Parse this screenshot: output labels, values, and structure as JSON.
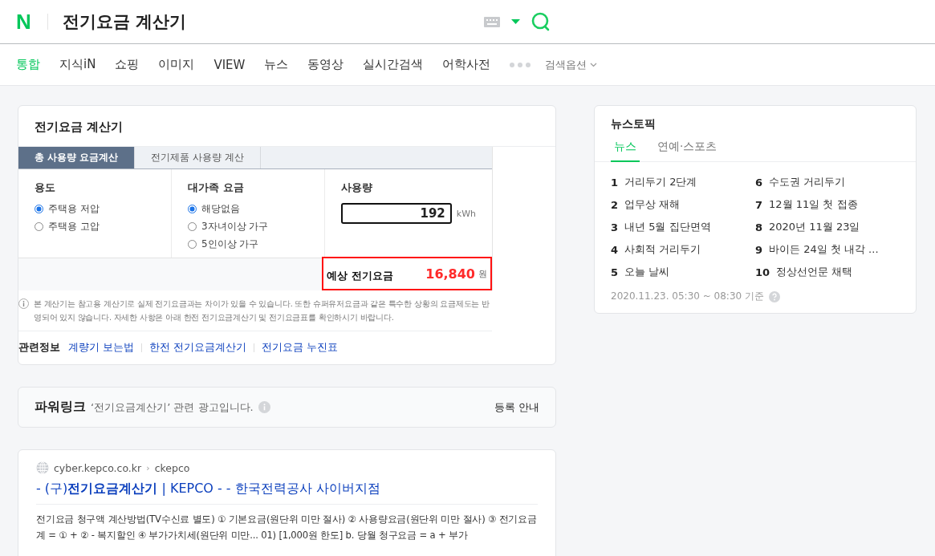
{
  "header": {
    "logo": "N",
    "query": "전기요금 계산기"
  },
  "nav": {
    "items": [
      {
        "label": "통합",
        "selected": true
      },
      {
        "label": "지식iN",
        "selected": false
      },
      {
        "label": "쇼핑",
        "selected": false
      },
      {
        "label": "이미지",
        "selected": false
      },
      {
        "label": "VIEW",
        "selected": false
      },
      {
        "label": "뉴스",
        "selected": false
      },
      {
        "label": "동영상",
        "selected": false
      },
      {
        "label": "실시간검색",
        "selected": false
      },
      {
        "label": "어학사전",
        "selected": false
      }
    ],
    "options": "검색옵션"
  },
  "calculator": {
    "title": "전기요금 계산기",
    "tabs": [
      {
        "label": "총 사용량 요금계산",
        "selected": true
      },
      {
        "label": "전기제품 사용량 계산",
        "selected": false
      }
    ],
    "groups": [
      {
        "title": "용도",
        "options": [
          {
            "label": "주택용 저압",
            "selected": true
          },
          {
            "label": "주택용 고압",
            "selected": false
          }
        ]
      },
      {
        "title": "대가족 요금",
        "options": [
          {
            "label": "해당없음",
            "selected": true
          },
          {
            "label": "3자녀이상 가구",
            "selected": false
          },
          {
            "label": "5인이상 가구",
            "selected": false
          }
        ]
      }
    ],
    "usage": {
      "title": "사용량",
      "value": "192",
      "unit": "kWh"
    },
    "result": {
      "label": "예상 전기요금",
      "amount": "16,840",
      "unit": "원"
    },
    "notice": "본 계산기는 참고용 계산기로 실제 전기요금과는 차이가 있을 수 있습니다. 또한 슈퍼유저요금과 같은 특수한 상황의 요금제도는 반영되어 있지 않습니다. 자세한 사항은 아래 한전 전기요금계산기 및 전기요금표를 확인하시기 바랍니다.",
    "related": {
      "label": "관련정보",
      "links": [
        "계량기 보는법",
        "한전 전기요금계산기",
        "전기요금 누진표"
      ]
    }
  },
  "powerlink": {
    "title": "파워링크",
    "description": "‘전기요금계산기’ 관련 광고입니다.",
    "register": "등록 안내"
  },
  "result": {
    "site": "cyber.kepco.co.kr",
    "separator": "›",
    "path": "ckepco",
    "title": "- (구)**전기요금계산기** | KEPCO - - 한국전력공사 사이버지점",
    "snippet": "전기요금 청구액 계산방법(TV수신료 별도) ① 기본요금(원단위 미만 절사) ② 사용량요금(원단위 미만 절사) ③ 전기요금계 = ① + ② - 복지할인 ④ 부가가치세(원단위 미만... 01) [1,000원 한도] b. 당월 청구요금 = a + 부가"
  },
  "news": {
    "title": "뉴스토픽",
    "tabs": [
      {
        "label": "뉴스",
        "selected": true
      },
      {
        "label": "연예·스포츠",
        "selected": false
      }
    ],
    "items": [
      {
        "rank": "1",
        "text": "거리두기 2단계"
      },
      {
        "rank": "2",
        "text": "업무상 재해"
      },
      {
        "rank": "3",
        "text": "내년 5월 집단면역"
      },
      {
        "rank": "4",
        "text": "사회적 거리두기"
      },
      {
        "rank": "5",
        "text": "오늘 날씨"
      },
      {
        "rank": "6",
        "text": "수도권 거리두기"
      },
      {
        "rank": "7",
        "text": "12월 11일 첫 접종"
      },
      {
        "rank": "8",
        "text": "2020년 11월 23일"
      },
      {
        "rank": "9",
        "text": "바이든 24일 첫 내각 ..."
      },
      {
        "rank": "10",
        "text": "정상선언문 채택"
      }
    ],
    "timestamp": "2020.11.23. 05:30 ~ 08:30 기준"
  }
}
